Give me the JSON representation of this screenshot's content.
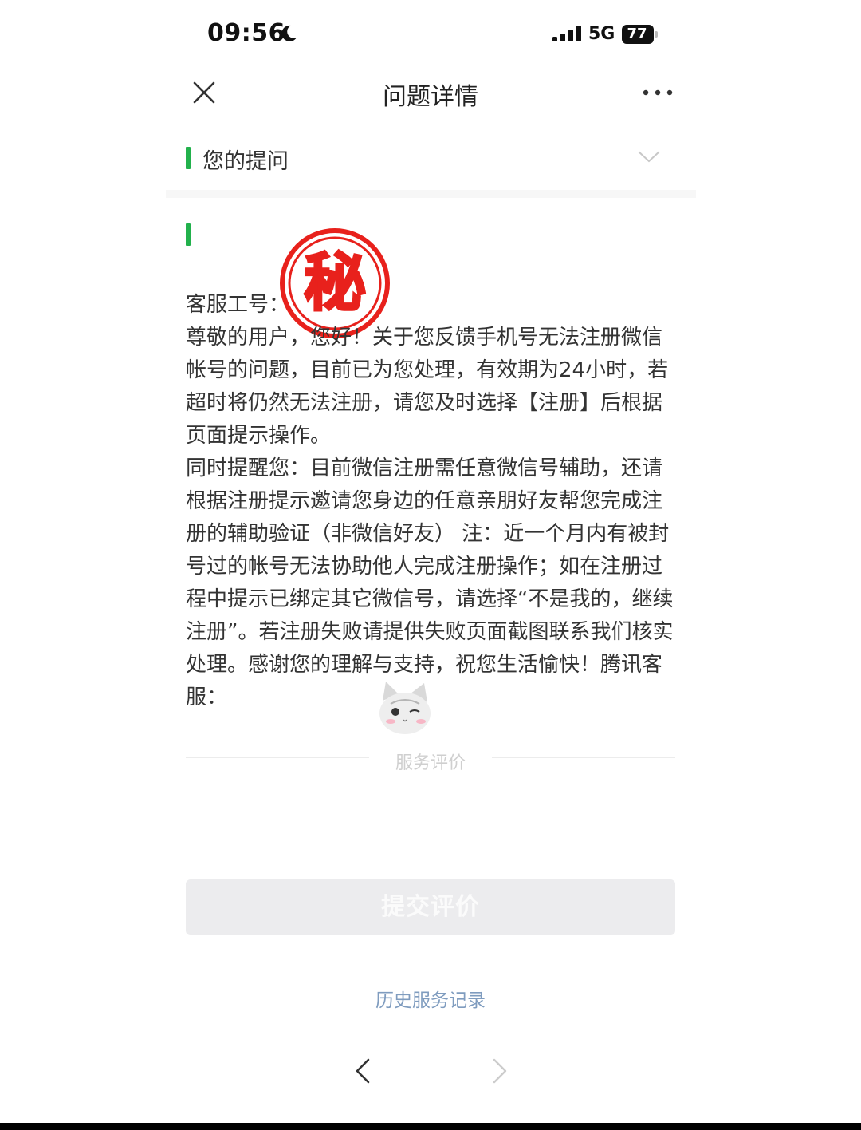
{
  "status_bar": {
    "time": "09:56",
    "network": "5G",
    "battery": "77"
  },
  "nav": {
    "title": "问题详情"
  },
  "question": {
    "label": "您的提问"
  },
  "stamp": {
    "text": "秘"
  },
  "message": {
    "agent_prefix": "客服工号：",
    "paragraph1": "尊敬的用户，您好！关于您反馈手机号无法注册微信帐号的问题，目前已为您处理，有效期为24小时，若超时将仍然无法注册，请您及时选择【注册】后根据页面提示操作。",
    "paragraph2": "同时提醒您：目前微信注册需任意微信号辅助，还请根据注册提示邀请您身边的任意亲朋好友帮您完成注册的辅助验证（非微信好友） 注：近一个月内有被封号过的帐号无法协助他人完成注册操作；如在注册过程中提示已绑定其它微信号，请选择“不是我的，继续注册”。若注册失败请提供失败页面截图联系我们核实处理。感谢您的理解与支持，祝您生活愉快！腾讯客服："
  },
  "rating": {
    "label": "服务评价"
  },
  "submit": {
    "label": "提交评价"
  },
  "history": {
    "label": "历史服务记录"
  },
  "colors": {
    "accent_green": "#22b14c",
    "stamp_red": "#e8211c",
    "link_blue": "#7f9cbf"
  }
}
